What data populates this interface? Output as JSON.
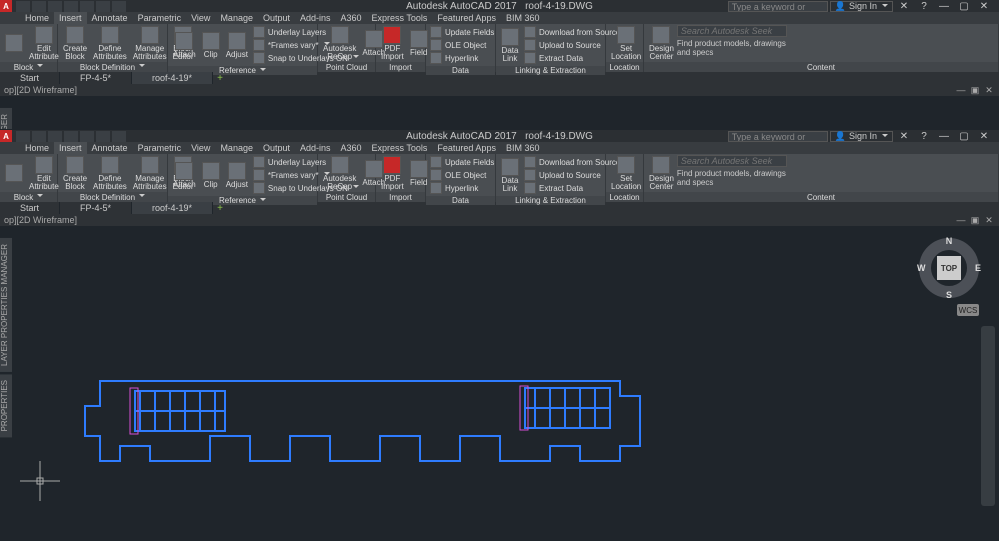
{
  "app": {
    "name": "Autodesk AutoCAD 2017",
    "document": "roof-4-19.DWG",
    "search_placeholder": "Type a keyword or phrase",
    "signin": "Sign In",
    "viewport_label": "op][2D Wireframe]"
  },
  "rtabs": [
    "Home",
    "Insert",
    "Annotate",
    "Parametric",
    "View",
    "Manage",
    "Output",
    "Add-ins",
    "A360",
    "Express Tools",
    "Featured Apps",
    "BIM 360"
  ],
  "rtab_active": 1,
  "ribbon": {
    "block": {
      "title": "Block",
      "edit_attribute": "Edit\nAttribute"
    },
    "blockdef": {
      "title": "Block Definition",
      "create_block": "Create\nBlock",
      "define_attrs": "Define\nAttributes",
      "manage_attrs": "Manage\nAttributes",
      "block_editor": "Block\nEditor"
    },
    "ref": {
      "title": "Reference",
      "attach": "Attach",
      "clip": "Clip",
      "adjust": "Adjust",
      "underlay": "Underlay Layers",
      "frames": "*Frames vary*",
      "snap": "Snap to Underlays ON"
    },
    "ptcloud": {
      "title": "Point Cloud",
      "recap": "Autodesk\nReCap",
      "attach": "Attach"
    },
    "import": {
      "title": "Import",
      "pdf": "PDF\nImport",
      "field": "Field"
    },
    "data": {
      "title": "Data",
      "update": "Update Fields",
      "ole": "OLE Object",
      "hyperlink": "Hyperlink"
    },
    "link": {
      "title": "Linking & Extraction",
      "datalink": "Data\nLink",
      "download": "Download from Source",
      "upload": "Upload to Source",
      "extract": "Extract  Data"
    },
    "loc": {
      "title": "Location",
      "set": "Set\nLocation"
    },
    "content": {
      "title": "Content",
      "dc": "Design\nCenter",
      "seek_placeholder": "Search Autodesk Seek",
      "seek_text": "Find product models, drawings and specs"
    }
  },
  "doctabs": {
    "start": "Start",
    "fp": "FP-4-5*",
    "roof": "roof-4-19*"
  },
  "viewcube": {
    "top": "TOP",
    "n": "N",
    "s": "S",
    "e": "E",
    "w": "W",
    "wcs": "WCS"
  },
  "side": {
    "props": "PROPERTIES",
    "layer": "LAYER PROPERTIES MANAGER"
  }
}
